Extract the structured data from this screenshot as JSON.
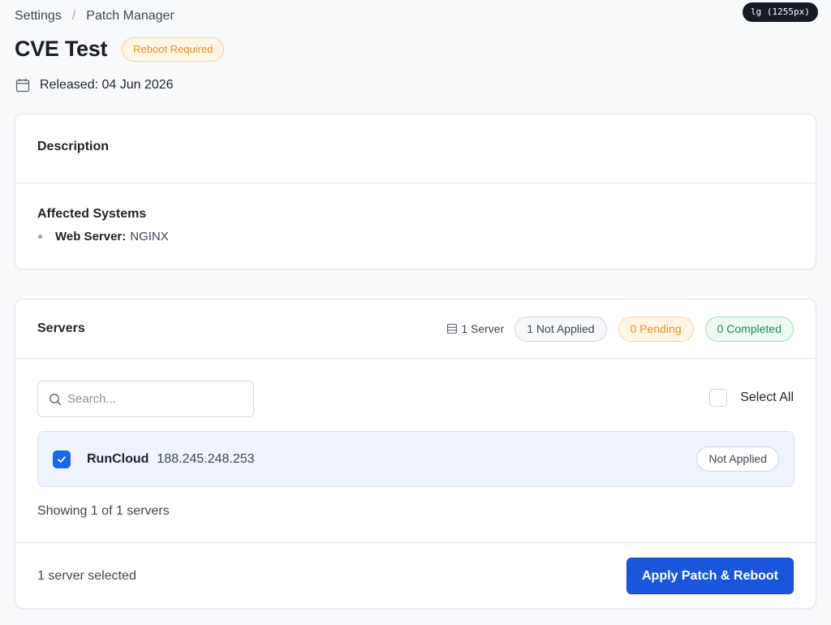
{
  "viewport_badge": "lg (1255px)",
  "breadcrumb": {
    "items": [
      "Settings",
      "Patch Manager"
    ],
    "separator": "/"
  },
  "page": {
    "title": "CVE Test",
    "status_badge": "Reboot Required"
  },
  "released": {
    "label": "Released: 04 Jun 2026",
    "icon": "calendar-icon"
  },
  "description_card": {
    "heading": "Description",
    "affected_title": "Affected Systems",
    "affected_items": [
      {
        "key": "Web Server:",
        "value": "NGINX"
      }
    ]
  },
  "servers_card": {
    "title": "Servers",
    "server_count": "1 Server",
    "pills": {
      "not_applied": "1 Not Applied",
      "pending": "0 Pending",
      "completed": "0 Completed"
    },
    "search": {
      "placeholder": "Search...",
      "value": ""
    },
    "select_all_label": "Select All",
    "select_all_checked": false,
    "rows": [
      {
        "name": "RunCloud",
        "ip": "188.245.248.253",
        "status": "Not Applied",
        "checked": true
      }
    ],
    "showing": "Showing 1 of 1 servers",
    "selected_count": "1 server selected",
    "apply_button": "Apply Patch & Reboot"
  },
  "colors": {
    "accent": "#1a56db",
    "checkbox": "#1769e8",
    "warning": "#e3901c",
    "success": "#1f8a55"
  }
}
